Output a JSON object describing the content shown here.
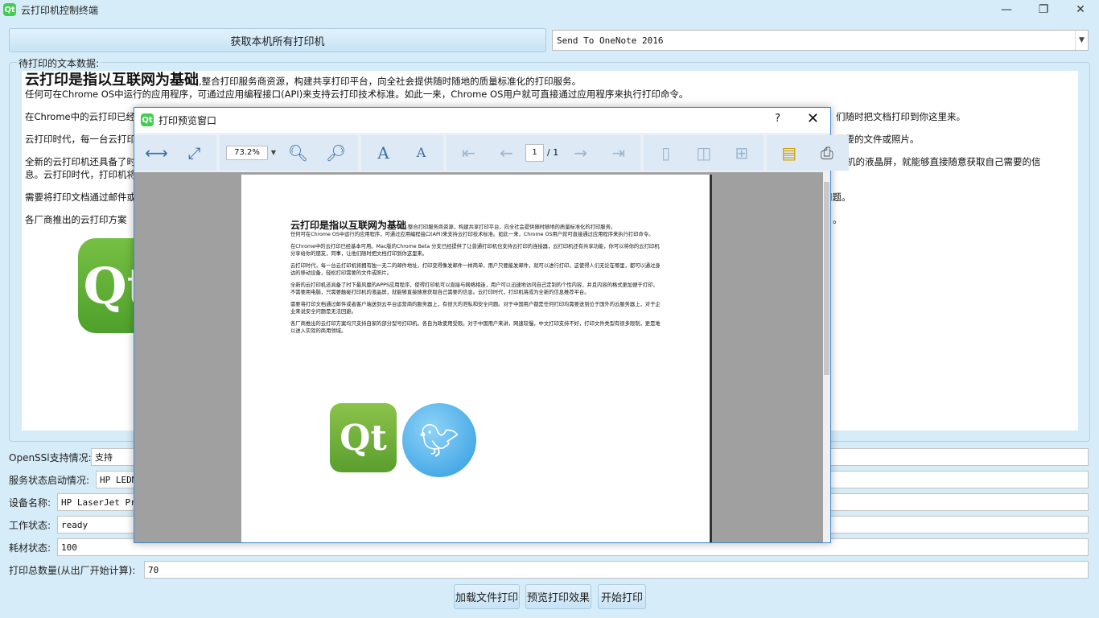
{
  "window": {
    "title": "云打印机控制终端",
    "app_icon": "Qt",
    "controls": {
      "minimize": "—",
      "maximize": "❐",
      "close": "✕"
    }
  },
  "toolbar": {
    "get_printers_label": "获取本机所有打印机",
    "printer_selected": "Send To OneNote 2016"
  },
  "text_group": {
    "legend": "待打印的文本数据:",
    "heading": "云打印是指以互联网为基础",
    "heading_rest": ",整合打印服务商资源，构建共享打印平台，向全社会提供随时随地的质量标准化的打印服务。",
    "line2": " 任何可在Chrome OS中运行的应用程序，可通过应用编程接口(API)来支持云打印技术标准。如此一来，Chrome OS用户就可直接通过应用程序来执行打印命令。",
    "p1_left": "在Chrome中的云打印已经基",
    "p1_right": "们随时把文档打印到你这里来。",
    "p2_left": "云打印时代，每一台云打印",
    "p2_right": "需要的文件或照片。",
    "p3_left": "全新的云打印机还具备了时",
    "p3_right": "打印机的液晶屏，就能够直接随意获取自己需要的信",
    "p3_left2": "息。云打印时代，打印机将",
    "p4_left": "需要将打印文档通过邮件或",
    "p4_right": "问题。",
    "p5_left": " 各厂商推出的云打印方案",
    "p5_right": "。",
    "logo_icon": "qt-logo"
  },
  "form": {
    "openssl_label": "OpenSSl支持情况:",
    "openssl_value": "支持",
    "service_label": "服务状态启动情况:",
    "service_value": "HP LEDM",
    "device_label": "设备名称:",
    "device_value": "HP LaserJet Pro",
    "work_label": "工作状态:",
    "work_value": "ready",
    "supply_label": "耗材状态:",
    "supply_value": "100",
    "total_label": "打印总数量(从出厂开始计算):",
    "total_value": "70"
  },
  "actions": {
    "load_file": "加载文件打印",
    "preview": "预览打印效果",
    "start": "开始打印"
  },
  "dialog": {
    "title": "打印预览窗口",
    "help": "?",
    "close": "✕",
    "zoom": "73.2%",
    "page_current": "1",
    "page_total": "/ 1",
    "page": {
      "heading": "云打印是指以互联网为基础",
      "heading_rest": ",整合打印服务商资源，构建共享打印平台，向全社会提供随时随地的质量标准化的打印服务。",
      "line2": " 任何可在Chrome OS中运行的应用程序，可通过应用编程接口(API)来支持云打印技术标准。如此一来，Chrome OS用户就可直接通过应用程序来执行打印命令。",
      "p1": "在Chrome中的云打印已经基本可用。Mac版的Chrome Beta 分支已经提供了让普通打印机也支持云打印的连接器，云打印机还有共享功能，你可以将你的云打印机分享给你的朋友，同事，让他们随时把文档打印到你这里来。",
      "p2": "云打印时代，每一台云打印机将拥有独一无二的邮件地址，打印变得像发邮件一样简单，用户只要能发邮件，就可以进行打印。这使得人们无论在哪里，都可以通过身边的移动设备，轻松打印需要的文件或照片。",
      "p3": "全新的云打印机还具备了时下最风靡的APPS应用程序，使得打印机可以直接与网络相连，用户可以迅速地访问自己定制的个性内容，并且内容的格式更加便于打印，不需要用电脑，只需要触碰打印机的液晶屏，就能够直接随意获取自己需要的信息。云打印时代，打印机将成为全新的信息推荐平台。",
      "p4": "需要将打印文档通过邮件或者客户端送到云平台运营商的服务器上，有很大的泄私和安全问题。对于中国用户都是任何打印均需要送到位于国外的云服务器上，对于企业来说安全问题是无法回避。",
      "p5": " 各厂商推出的云打印方案均只支持自家的部分型号打印机，各自为政使用受限。对于中国用户来讲，网速较慢，中文打印支持不好，打印文件类型有很多限制，更是难以进入实际的商用领域。"
    }
  }
}
